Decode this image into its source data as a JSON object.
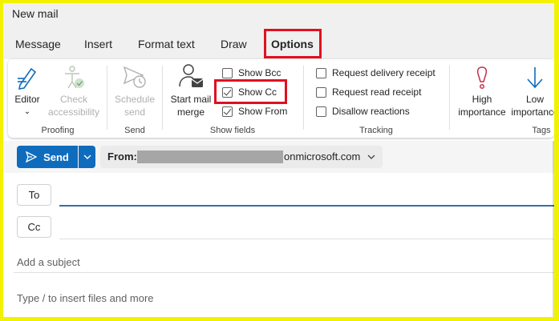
{
  "window": {
    "title": "New mail"
  },
  "tabs": [
    {
      "label": "Message"
    },
    {
      "label": "Insert"
    },
    {
      "label": "Format text"
    },
    {
      "label": "Draw"
    },
    {
      "label": "Options"
    }
  ],
  "ribbon": {
    "proofing": {
      "label": "Proofing",
      "editor_label": "Editor",
      "check_line1": "Check",
      "check_line2": "accessibility"
    },
    "send": {
      "label": "Send",
      "schedule_line1": "Schedule",
      "schedule_line2": "send"
    },
    "show_fields": {
      "label": "Show fields",
      "merge_line1": "Start mail",
      "merge_line2": "merge",
      "show_bcc": "Show Bcc",
      "show_cc": "Show Cc",
      "show_from": "Show From"
    },
    "tracking": {
      "label": "Tracking",
      "delivery": "Request delivery receipt",
      "read": "Request read receipt",
      "disallow": "Disallow reactions"
    },
    "tags": {
      "label": "Tags",
      "high_line1": "High",
      "high_line2": "importance",
      "low_line1": "Low",
      "low_line2": "importance"
    }
  },
  "compose": {
    "send_label": "Send",
    "from_label": "From:",
    "from_domain": "onmicrosoft.com",
    "to_label": "To",
    "cc_label": "Cc",
    "subject_placeholder": "Add a subject",
    "body_placeholder": "Type / to insert files and more"
  },
  "colors": {
    "accent": "#0f6cbd",
    "highlight": "#e01020",
    "frame": "#f2f200",
    "importance_high": "#c4314b"
  }
}
